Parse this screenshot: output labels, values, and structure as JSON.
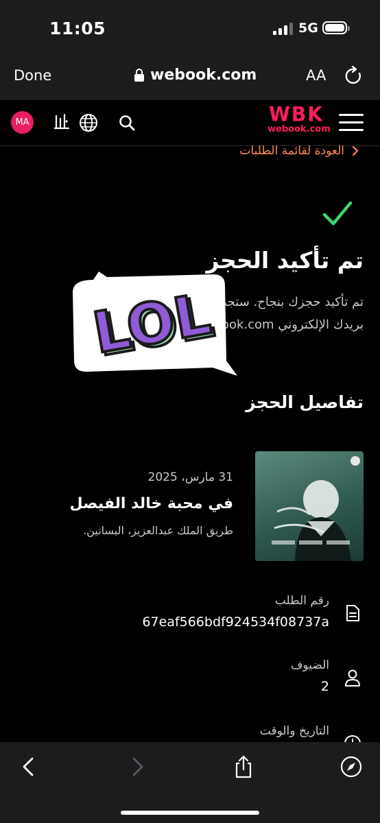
{
  "status_bar": {
    "time": "11:05",
    "network": "5G"
  },
  "browser": {
    "done_label": "Done",
    "url": "webook.com",
    "text_size_label": "AA"
  },
  "site_header": {
    "avatar_initials": "MA",
    "logo_text": "WBK",
    "logo_subtext": "webook.com"
  },
  "back_link": "العودة لقائمة الطلبات",
  "confirmation": {
    "title": "تم تأكيد الحجز",
    "description_line1": "تم تأكيد حجزك بنجاح. ستجد تفاصيل الحجز على",
    "description_line2": "بريدك الإلكتروني webook.com"
  },
  "sticker_text": "LOL",
  "booking_details": {
    "section_title": "تفاصيل الحجز",
    "event": {
      "date": "31 مارس، 2025",
      "name": "في محبة خالد الفيصل",
      "location": "طريق الملك عبدالعزيز، البساتين."
    },
    "order": {
      "label": "رقم الطلب",
      "value": "67eaf566bdf924534f08737a"
    },
    "guests": {
      "label": "الضيوف",
      "value": "2"
    },
    "datetime": {
      "label": "التاريخ والوقت"
    }
  },
  "colors": {
    "accent": "#ff1e5a",
    "check": "#3fd66b",
    "link": "#ff8a5c",
    "sticker": "#8f5bd6"
  }
}
